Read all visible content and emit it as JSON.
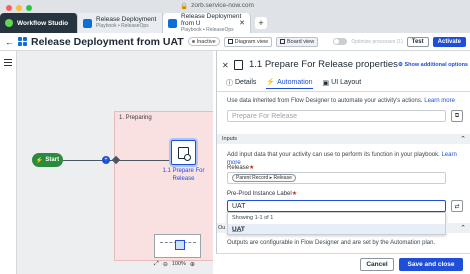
{
  "browser": {
    "url": "zorb.service-now.com",
    "colors": {
      "chrome": "#dfe3e8",
      "close": "#ff5f57",
      "minimize": "#febc2e",
      "zoom": "#28c840"
    },
    "tabs": [
      {
        "title": "Workflow Studio",
        "subtitle": "",
        "icon": "servicenow-logo-icon"
      },
      {
        "title": "Release Deployment",
        "subtitle": "Playbook • ReleaseOps",
        "icon": "playbook-icon"
      },
      {
        "title": "Release Deployment from U",
        "subtitle": "Playbook • ReleaseOps",
        "icon": "playbook-icon"
      }
    ],
    "new_tab": "+"
  },
  "header": {
    "title": "Release Deployment from UAT",
    "status": "Inactive",
    "diagram_view": "Diagram view",
    "board_view": "Board view",
    "optimize_label": "Optimize processes (1)",
    "test": "Test",
    "activate": "Activate",
    "accent": "#1f4fd8"
  },
  "canvas": {
    "lane_title": "1. Preparing",
    "start_label": "Start",
    "connector_badge": "+",
    "activity_label": "1.1 Prepare For Release",
    "zoom": "100%",
    "lane_color": "#f9e1e1",
    "start_color": "#2a8b3d"
  },
  "panel": {
    "title": "1.1 Prepare For Release properties",
    "show_options": "Show additional options",
    "tabs": [
      {
        "label": "Details",
        "icon": "info-icon"
      },
      {
        "label": "Automation",
        "icon": "lightning-icon"
      },
      {
        "label": "UI Layout",
        "icon": "layout-icon"
      }
    ],
    "automation_desc": "Use data inherited from Flow Designer to automate your activity's actions.",
    "automation_learn": "Learn more",
    "automation_value": "Prepare For Release",
    "inputs_header": "Inputs",
    "inputs_desc": "Add input data that your activity can use to perform its function in your playbook.",
    "inputs_learn": "Learn more",
    "release_label": "Release",
    "release_chip": "Parent Record ▸ Release",
    "preprod_label": "Pre-Prod Instance Label",
    "preprod_value": "UAT",
    "dropdown_count": "Showing 1-1 of 1",
    "dropdown_option": "UAT",
    "outputs_header": "Ou",
    "outputs_desc": "Outputs are configurable in Flow Designer and are set by the Automation plan."
  },
  "footer": {
    "cancel": "Cancel",
    "save_close": "Save and close"
  }
}
